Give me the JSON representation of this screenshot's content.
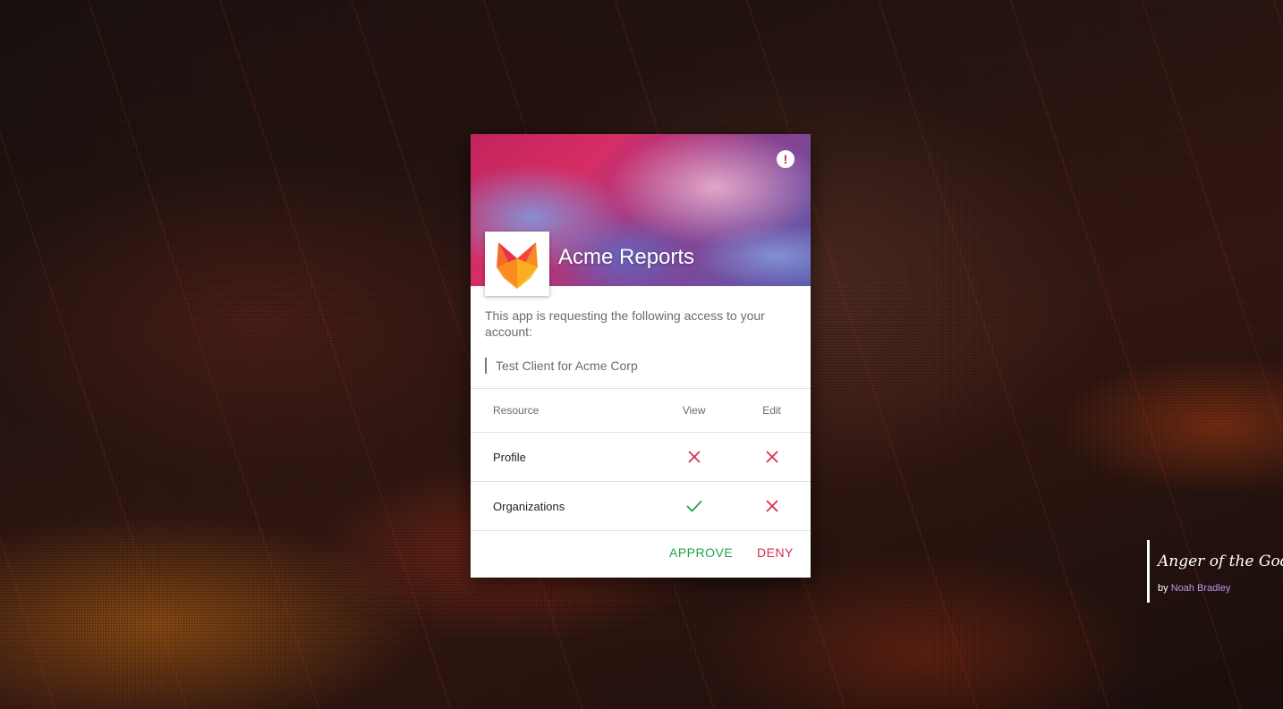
{
  "dialog": {
    "app_name": "Acme Reports",
    "request_text": "This app is requesting the following access to your account:",
    "client_name": "Test Client for Acme Corp",
    "alert_icon": "exclamation-circle-icon",
    "logo_icon": "fox-logo-icon",
    "permissions": {
      "headers": {
        "resource": "Resource",
        "view": "View",
        "edit": "Edit"
      },
      "rows": [
        {
          "resource": "Profile",
          "view": false,
          "edit": false
        },
        {
          "resource": "Organizations",
          "view": true,
          "edit": false
        }
      ]
    },
    "actions": {
      "approve": "APPROVE",
      "deny": "DENY"
    }
  },
  "credits": {
    "title": "Anger of the Gods",
    "by": "by",
    "author": "Noah Bradley"
  },
  "colors": {
    "approve": "#22a34a",
    "deny": "#d6324f",
    "check": "#22a34a",
    "cross": "#d6324f",
    "author_link": "#b99af0"
  }
}
